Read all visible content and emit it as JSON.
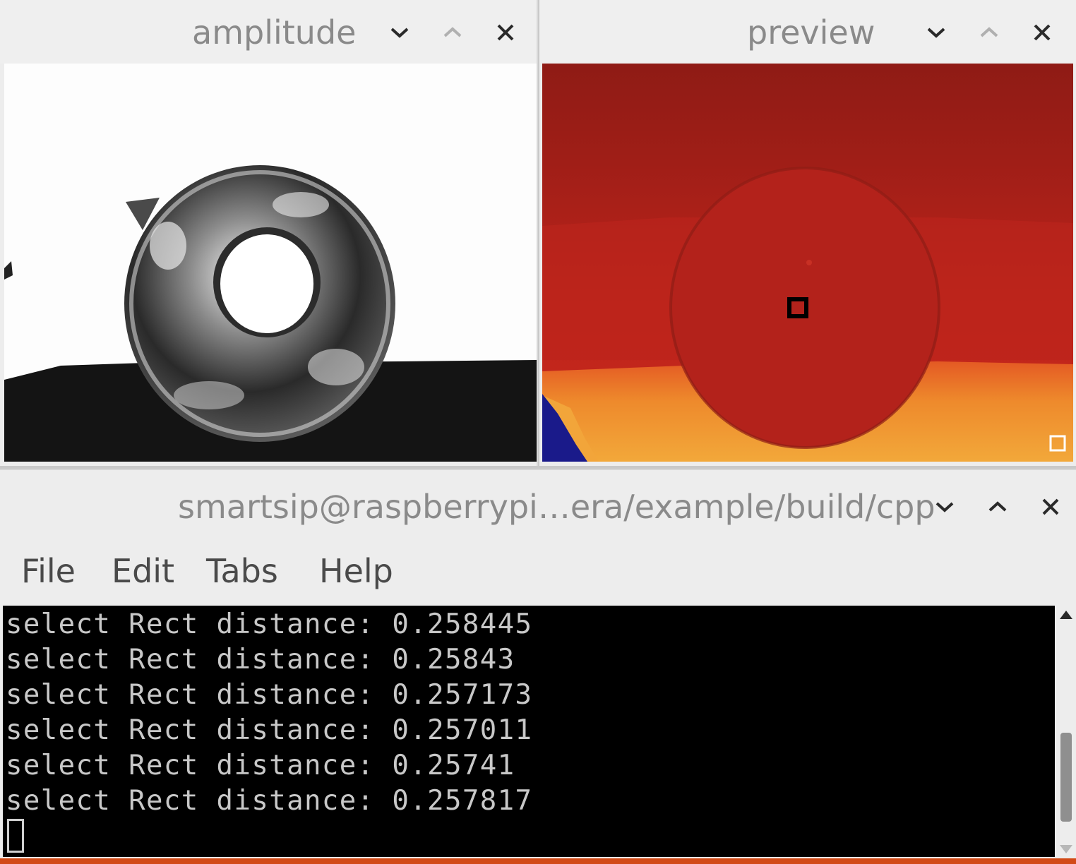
{
  "windows": {
    "amplitude": {
      "title": "amplitude",
      "buttons": {
        "minimize": "chevron-down-icon",
        "maximize": "chevron-up-icon",
        "close": "close-icon"
      }
    },
    "preview": {
      "title": "preview",
      "buttons": {
        "minimize": "chevron-down-icon",
        "maximize": "chevron-up-icon",
        "close": "close-icon"
      }
    },
    "terminal": {
      "title": "smartsip@raspberrypi…era/example/build/cpp",
      "menu": [
        "File",
        "Edit",
        "Tabs",
        "Help"
      ],
      "lines": [
        "select Rect distance: 0.258445",
        "select Rect distance: 0.25843",
        "select Rect distance: 0.257173",
        "select Rect distance: 0.257011",
        "select Rect distance: 0.25741",
        "select Rect distance: 0.257817"
      ]
    }
  },
  "colors": {
    "title_text": "#8a8a8a",
    "terminal_bg": "#000000",
    "terminal_fg": "#c8c8c8",
    "preview_far": "#8f1b15",
    "preview_mid": "#bd241b",
    "preview_floor": "#f09030"
  }
}
